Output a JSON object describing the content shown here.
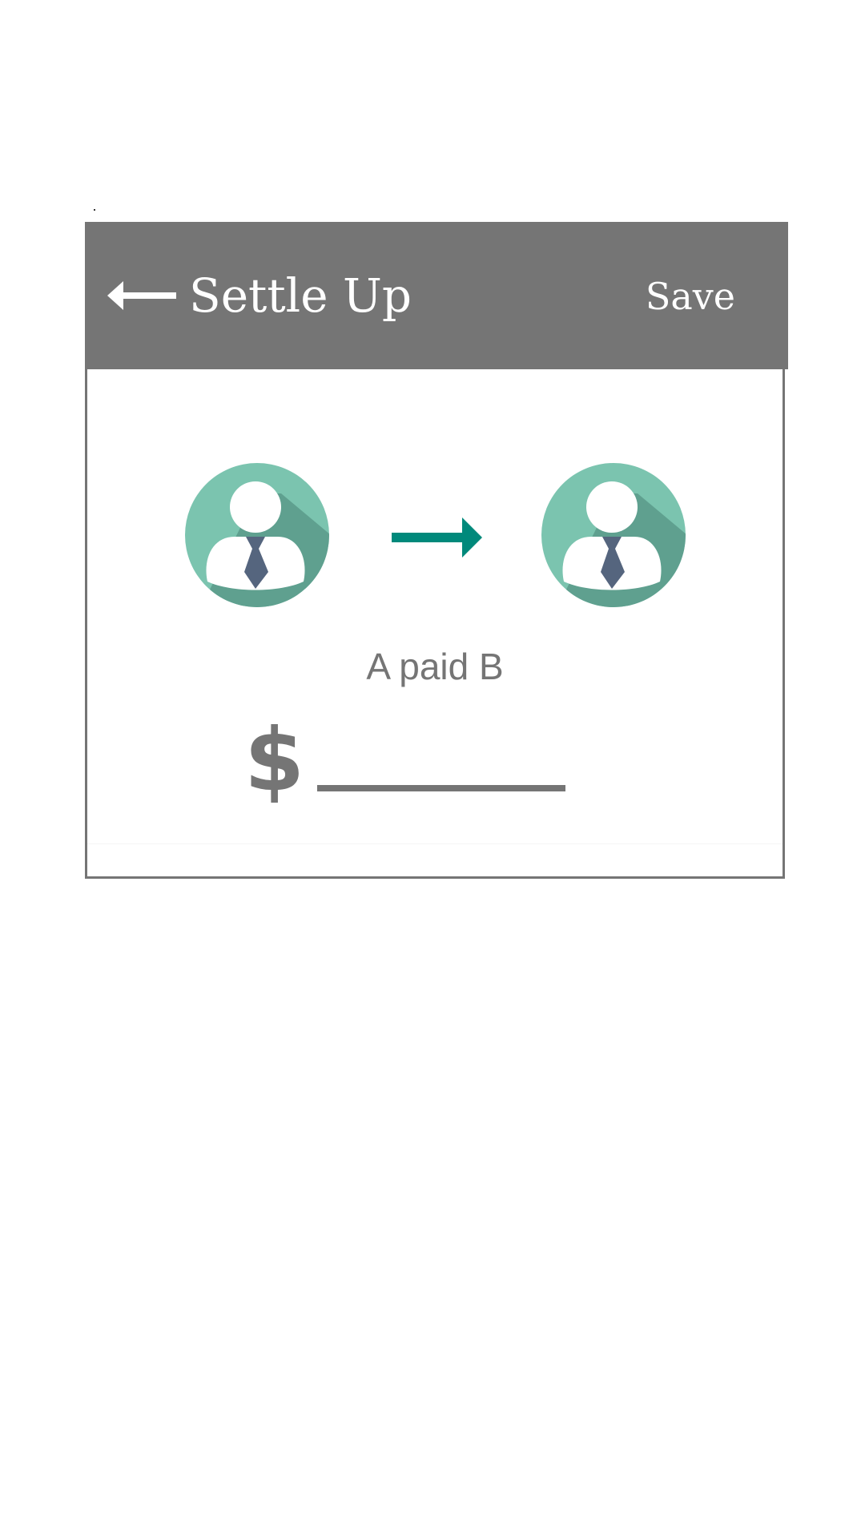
{
  "header": {
    "back_icon": "arrow-left-icon",
    "title": "Settle Up",
    "save_label": "Save"
  },
  "payment": {
    "payer_icon": "person-avatar-icon",
    "direction_icon": "arrow-right-icon",
    "payee_icon": "person-avatar-icon",
    "description": "A paid B",
    "currency_symbol": "$",
    "amount_value": "",
    "amount_placeholder": ""
  },
  "colors": {
    "appbar": "#757575",
    "text_muted": "#757575",
    "accent_arrow": "#00897b",
    "avatar_bg": "#7bc4af",
    "avatar_shadow": "#5fa08f",
    "tie": "#55657e"
  }
}
